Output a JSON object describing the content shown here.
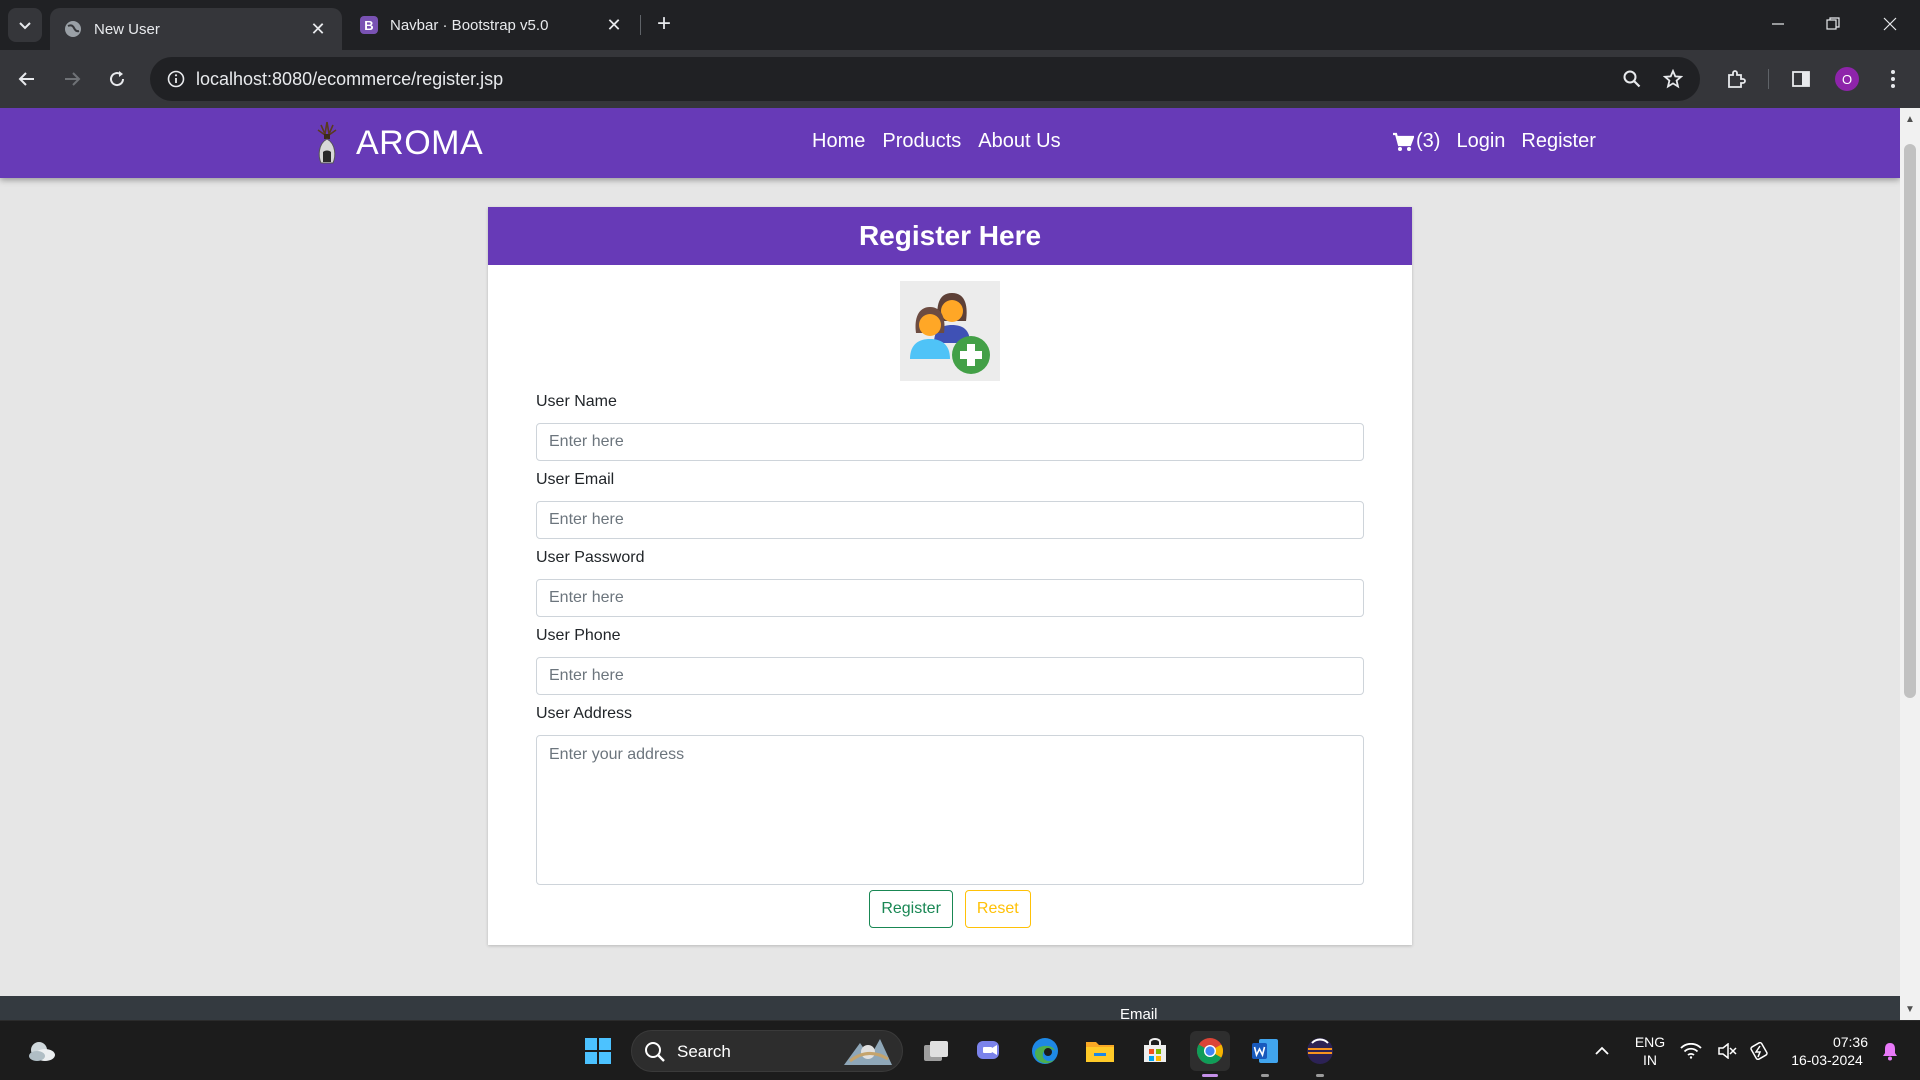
{
  "browser": {
    "tabs": [
      {
        "title": "New User",
        "active": true
      },
      {
        "title": "Navbar · Bootstrap v5.0",
        "active": false
      }
    ],
    "bootstrap_favicon": "B",
    "url": "localhost:8080/ecommerce/register.jsp",
    "profile_initial": "O",
    "accent_colors": {
      "chrome_dark": "#202124",
      "chrome_toolbar": "#35363a",
      "profile": "#8e24aa"
    }
  },
  "site": {
    "brand": "AROMA",
    "nav_links": [
      "Home",
      "Products",
      "About Us"
    ],
    "cart_count": "(3)",
    "login": "Login",
    "register": "Register",
    "colors": {
      "primary": "#673ab7",
      "success": "#198754",
      "warning": "#ffc107"
    }
  },
  "card": {
    "title": "Register Here",
    "avatar_icon": "add-users-icon"
  },
  "form": {
    "fields": [
      {
        "label": "User Name",
        "placeholder": "Enter here",
        "value": ""
      },
      {
        "label": "User Email",
        "placeholder": "Enter here",
        "value": ""
      },
      {
        "label": "User Password",
        "placeholder": "Enter here",
        "value": ""
      },
      {
        "label": "User Phone",
        "placeholder": "Enter here",
        "value": ""
      },
      {
        "label": "User Address",
        "placeholder": "Enter your address",
        "value": ""
      }
    ],
    "buttons": {
      "register": "Register",
      "reset": "Reset"
    }
  },
  "footer": {
    "partial_text": "Email"
  },
  "taskbar": {
    "search_label": "Search",
    "language": "ENG",
    "region": "IN",
    "time": "07:36",
    "date": "16-03-2024"
  }
}
